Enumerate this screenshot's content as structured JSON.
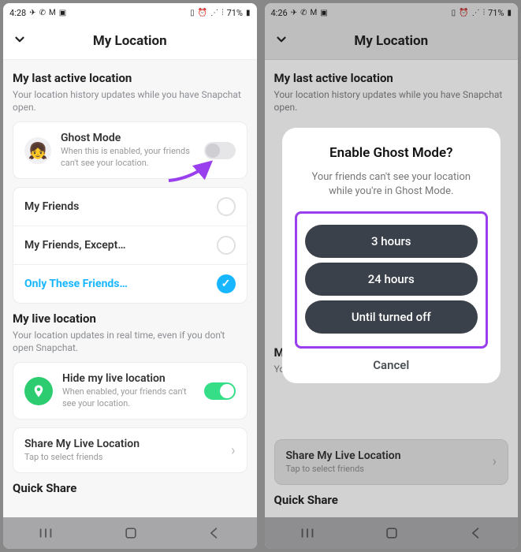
{
  "status": {
    "time_left": "4:28",
    "time_right": "4:26",
    "battery": "71%"
  },
  "header": {
    "title": "My Location"
  },
  "last_active": {
    "title": "My last active location",
    "subtitle": "Your location history updates while you have Snapchat open."
  },
  "ghost": {
    "title": "Ghost Mode",
    "subtitle": "When this is enabled, your friends can't see your location."
  },
  "options": {
    "my_friends": "My Friends",
    "except": "My Friends, Except…",
    "only": "Only These Friends…"
  },
  "live": {
    "title": "My live location",
    "subtitle": "Your location updates in real time, even if you don't open Snapchat."
  },
  "hide": {
    "title": "Hide my live location",
    "subtitle": "When enabled, your friends can't see your location."
  },
  "share": {
    "title": "Share My Live Location",
    "subtitle": "Tap to select friends"
  },
  "quick_share": "Quick Share",
  "modal": {
    "title": "Enable Ghost Mode?",
    "subtitle": "Your friends can't see your location while you're in Ghost Mode.",
    "opt1": "3 hours",
    "opt2": "24 hours",
    "opt3": "Until turned off",
    "cancel": "Cancel"
  },
  "colors": {
    "accent_blue": "#17b6ff",
    "accent_green": "#2ecc71",
    "annotation_purple": "#9a3fed",
    "pill_dark": "#3b414a"
  }
}
